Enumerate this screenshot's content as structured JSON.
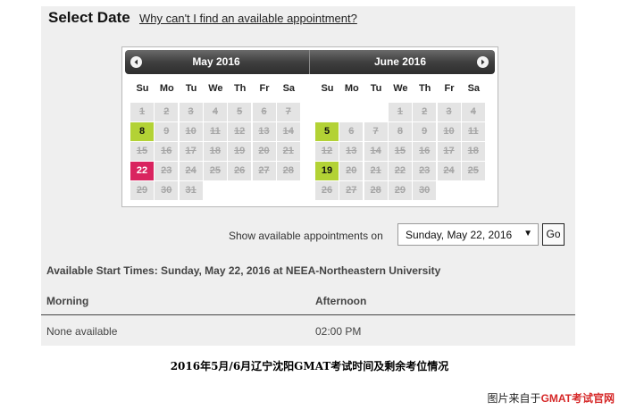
{
  "header": {
    "title": "Select Date",
    "help_link": "Why can't I find an available appointment?"
  },
  "calendar": {
    "prev_icon": "chevron-left-icon",
    "next_icon": "chevron-right-icon",
    "weekdays": [
      "Su",
      "Mo",
      "Tu",
      "We",
      "Th",
      "Fr",
      "Sa"
    ],
    "months": [
      {
        "title": "May 2016",
        "first_weekday": 0,
        "days_in_month": 31,
        "available": [
          8,
          22
        ],
        "selected": 22
      },
      {
        "title": "June 2016",
        "first_weekday": 3,
        "days_in_month": 30,
        "available": [
          5,
          19
        ],
        "selected": null
      }
    ],
    "colors": {
      "available": "#b3d235",
      "selected": "#d9245f"
    }
  },
  "filter": {
    "label": "Show available appointments on",
    "selected_date": "Sunday, May 22, 2016",
    "go_label": "Go"
  },
  "results": {
    "title": "Available Start Times: Sunday, May 22, 2016 at NEEA-Northeastern University",
    "morning_header": "Morning",
    "afternoon_header": "Afternoon",
    "morning_value": "None available",
    "afternoon_value": "02:00 PM"
  },
  "caption": "2016年5月/6月辽宁沈阳GMAT考试时间及剩余考位情况",
  "credit": {
    "prefix": "图片来自于",
    "brand": "GMAT考试官网"
  }
}
